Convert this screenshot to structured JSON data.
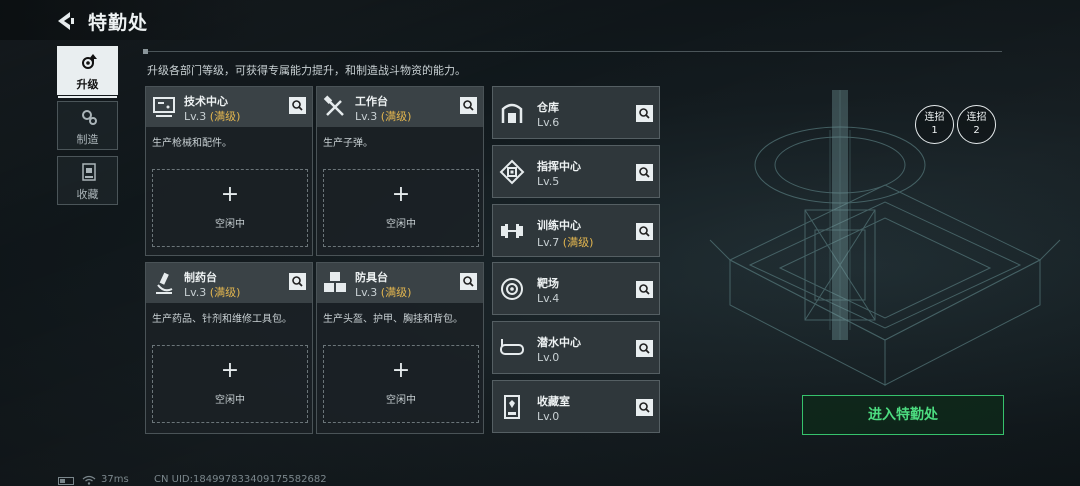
{
  "header": {
    "title": "特勤处"
  },
  "tabs": [
    {
      "label": "升级",
      "icon": "gear-arrow-up-icon",
      "active": true
    },
    {
      "label": "制造",
      "icon": "gears-icon",
      "active": false
    },
    {
      "label": "收藏",
      "icon": "collection-case-icon",
      "active": false
    }
  ],
  "description": "升级各部门等级，可获得专属能力提升，和制造战斗物资的能力。",
  "max_label": "(满级)",
  "idle_label": "空闲中",
  "plus": "+",
  "workshops": [
    {
      "name": "技术中心",
      "level": "Lv.3",
      "maxed": true,
      "desc": "生产枪械和配件。",
      "icon": "monitor-icon"
    },
    {
      "name": "工作台",
      "level": "Lv.3",
      "maxed": true,
      "desc": "生产子弹。",
      "icon": "tools-icon"
    },
    {
      "name": "制药台",
      "level": "Lv.3",
      "maxed": true,
      "desc": "生产药品、针剂和维修工具包。",
      "icon": "microscope-icon"
    },
    {
      "name": "防具台",
      "level": "Lv.3",
      "maxed": true,
      "desc": "生产头盔、护甲、胸挂和背包。",
      "icon": "armor-cubes-icon"
    }
  ],
  "facilities": [
    {
      "name": "仓库",
      "level": "Lv.6",
      "maxed": false,
      "icon": "warehouse-icon"
    },
    {
      "name": "指挥中心",
      "level": "Lv.5",
      "maxed": false,
      "icon": "command-chip-icon"
    },
    {
      "name": "训练中心",
      "level": "Lv.7",
      "maxed": true,
      "icon": "dumbbell-icon"
    },
    {
      "name": "靶场",
      "level": "Lv.4",
      "maxed": false,
      "icon": "target-icon"
    },
    {
      "name": "潜水中心",
      "level": "Lv.0",
      "maxed": false,
      "icon": "diving-mask-icon"
    },
    {
      "name": "收藏室",
      "level": "Lv.0",
      "maxed": false,
      "icon": "display-case-icon"
    }
  ],
  "combos": [
    {
      "line1": "连招",
      "line2": "1"
    },
    {
      "line1": "连招",
      "line2": "2"
    }
  ],
  "enter_button": "进入特勤处",
  "footer": {
    "ping": "37ms",
    "uid": "CN UID:1849978334091755826​82"
  },
  "colors": {
    "accent_green": "#4cdc80",
    "max_gold": "#e3b64f",
    "panel": "#2f373b"
  }
}
